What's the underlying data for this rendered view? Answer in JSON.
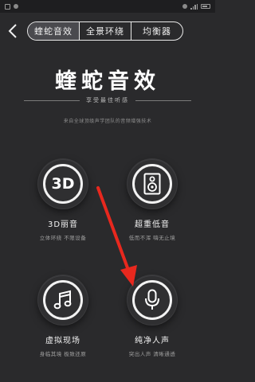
{
  "status": {
    "time": "",
    "icons": [
      "sim-icon",
      "location-icon",
      "wifi-icon",
      "signal-icon",
      "battery-icon"
    ]
  },
  "nav": {
    "tabs": [
      {
        "label": "蝰蛇音效",
        "active": true
      },
      {
        "label": "全景环绕",
        "active": false
      },
      {
        "label": "均衡器",
        "active": false
      }
    ]
  },
  "hero": {
    "title": "蝰蛇音效",
    "subtitle": "享受最佳听感",
    "description": "来自全球顶级声学团队的音频增强技术"
  },
  "effects": [
    {
      "name": "3D丽音",
      "sub": "立体环绕 不限设备",
      "icon": "3d-icon",
      "icon_text": "3D"
    },
    {
      "name": "超重低音",
      "sub": "低而不浑 嗨无止境",
      "icon": "speaker-icon"
    },
    {
      "name": "虚拟现场",
      "sub": "身临其境 极致还原",
      "icon": "music-note-icon"
    },
    {
      "name": "纯净人声",
      "sub": "突出人声 清晰通透",
      "icon": "microphone-icon"
    }
  ],
  "colors": {
    "background": "#2a2a2c",
    "accent_arrow": "#e8281e",
    "text": "#ffffff"
  }
}
